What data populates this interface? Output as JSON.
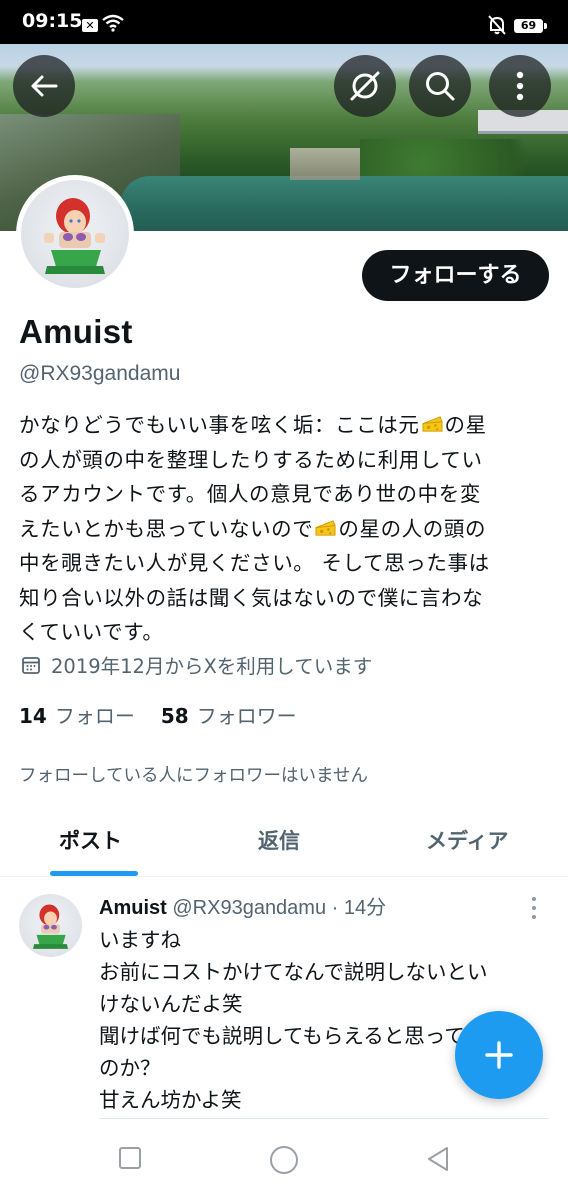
{
  "status": {
    "time": "09:15",
    "x_badge": "✕",
    "battery": "69"
  },
  "header": {
    "back_icon": "arrow-left-icon",
    "grok_icon": "slash-circle-icon",
    "search_icon": "search-icon",
    "more_icon": "more-vertical-icon"
  },
  "profile": {
    "follow_button": "フォローする",
    "display_name": "Amuist",
    "handle": "@RX93gandamu",
    "bio_lines": [
      [
        "かなりどうでもいい事を呟く垢：ここは元",
        "🧀",
        "の星"
      ],
      [
        "の人が頭の中を整理したりするために利用してい"
      ],
      [
        "るアカウントです。個人の意見であり世の中を変"
      ],
      [
        "えたいとかも思っていないので",
        "🧀",
        "の星の人の頭の"
      ],
      [
        "中を覗きたい人が見ください。 そして思った事は"
      ],
      [
        "知り合い以外の話は聞く気はないので僕に言わな"
      ],
      [
        "くていいです。"
      ]
    ],
    "joined": "2019年12月からXを利用しています",
    "following_count": "14",
    "following_label": "フォロー",
    "followers_count": "58",
    "followers_label": "フォロワー",
    "mutual_note": "フォローしている人にフォロワーはいません"
  },
  "tabs": [
    {
      "label": "ポスト",
      "active": true
    },
    {
      "label": "返信",
      "active": false
    },
    {
      "label": "メディア",
      "active": false
    }
  ],
  "post": {
    "name": "Amuist",
    "handle": "@RX93gandamu",
    "separator": " · ",
    "time": "14分",
    "lines": [
      "いますね",
      "お前にコストかけてなんで説明しないとい",
      "けないんだよ笑",
      "聞けば何でも説明してもらえると思ってん",
      "のか？",
      "甘えん坊かよ笑"
    ]
  },
  "fab_icon": "plus-icon",
  "nav": {
    "recent_icon": "square-icon",
    "home_icon": "circle-icon",
    "back_icon": "triangle-back-icon"
  },
  "colors": {
    "accent": "#1d9bf0",
    "text": "#0f1419",
    "muted": "#536471"
  }
}
